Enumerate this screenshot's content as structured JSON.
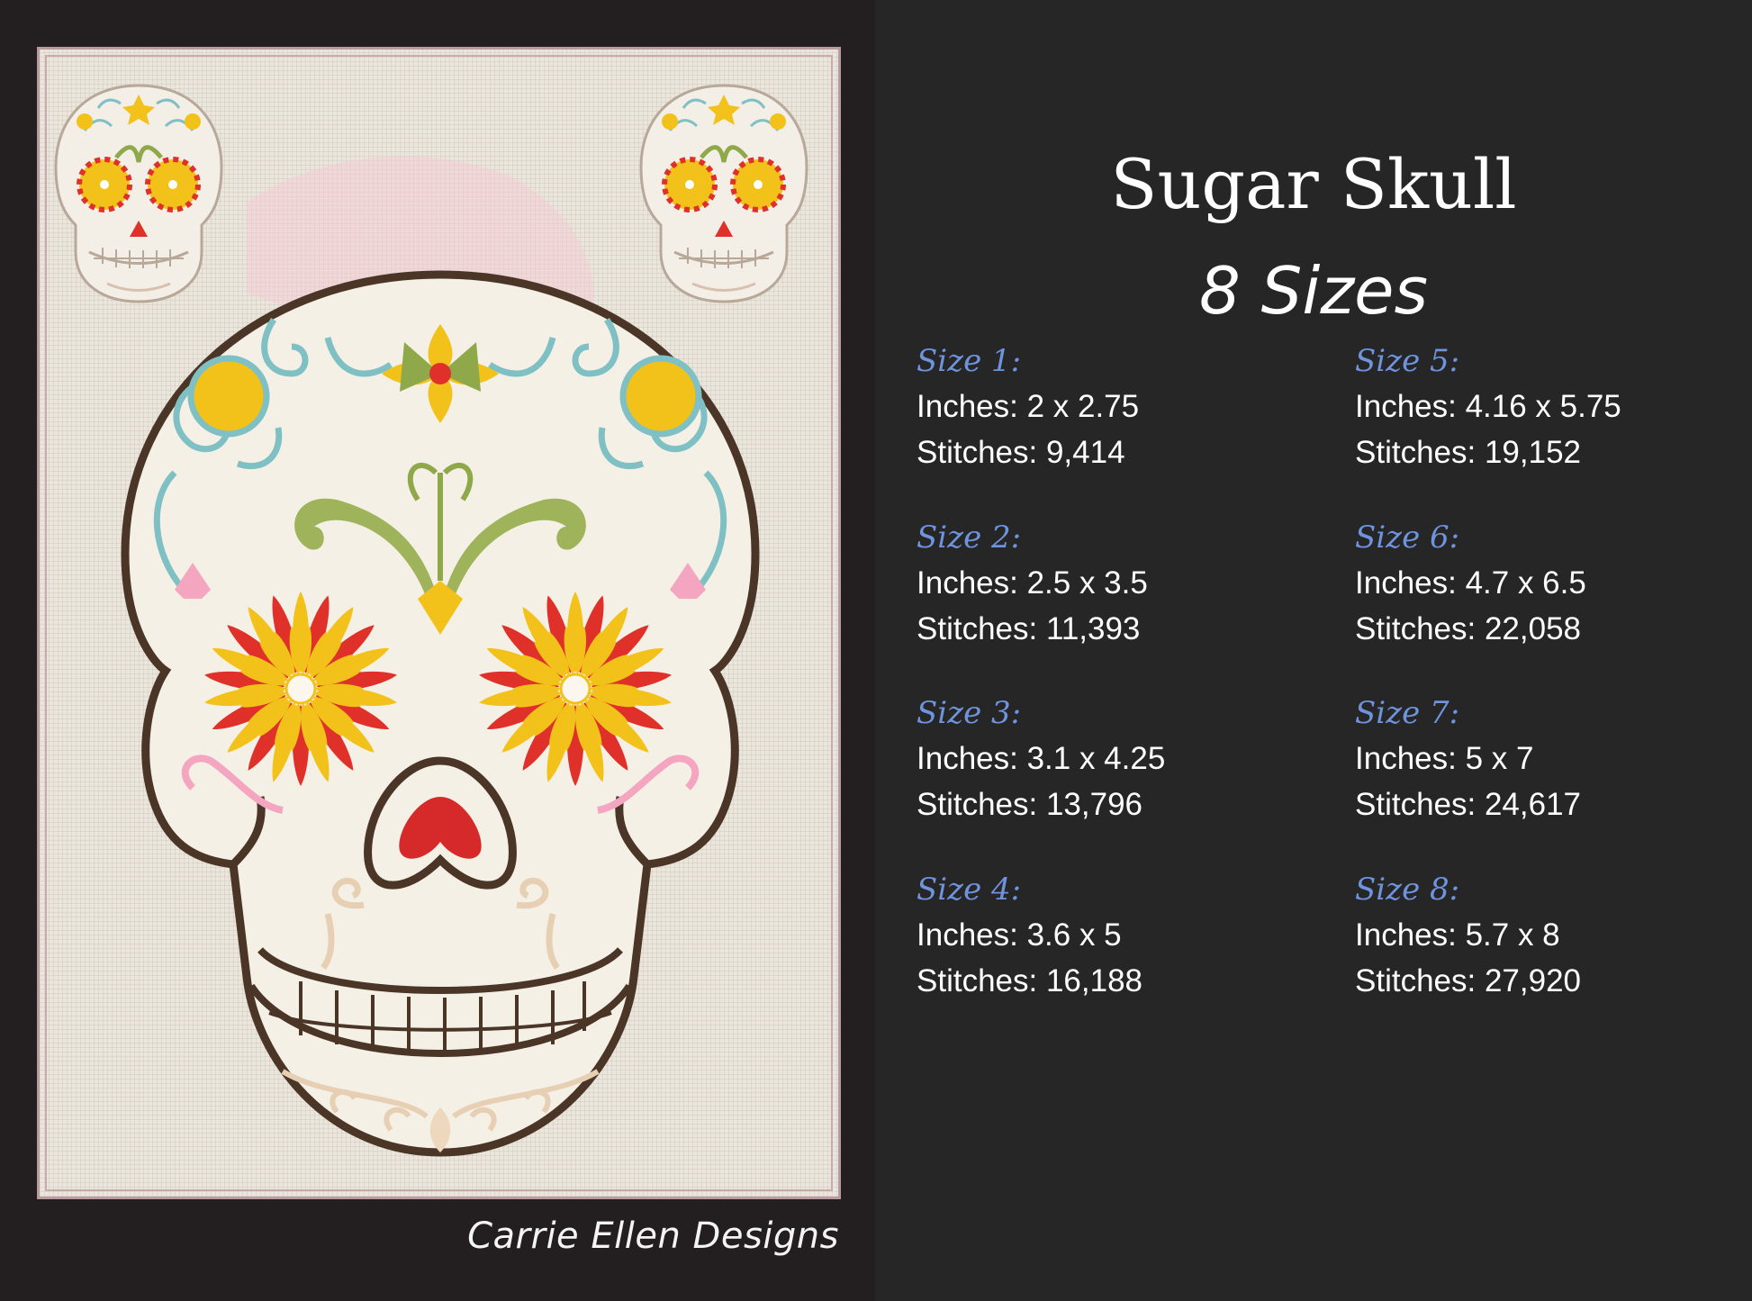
{
  "title": "Sugar Skull",
  "subtitle": "8 Sizes",
  "brand": "Carrie Ellen Designs",
  "colors": {
    "background": "#262626",
    "size_label": "#6f93dc",
    "text": "#ffffff",
    "outline": "#4a3527",
    "flower_red": "#e0302a",
    "flower_yellow": "#f2c21b",
    "leaf_green": "#8fa84a",
    "swirl_blue": "#7fc0c4"
  },
  "sizes": [
    {
      "label": "Size 1:",
      "inches": "Inches: 2 x 2.75",
      "stitches": "Stitches: 9,414"
    },
    {
      "label": "Size 2:",
      "inches": "Inches: 2.5 x 3.5",
      "stitches": "Stitches: 11,393"
    },
    {
      "label": "Size 3:",
      "inches": "Inches: 3.1 x 4.25",
      "stitches": "Stitches: 13,796"
    },
    {
      "label": "Size 4:",
      "inches": "Inches: 3.6 x 5",
      "stitches": "Stitches: 16,188"
    },
    {
      "label": "Size 5:",
      "inches": "Inches: 4.16 x 5.75",
      "stitches": "Stitches: 19,152"
    },
    {
      "label": "Size 6:",
      "inches": "Inches: 4.7 x 6.5",
      "stitches": "Stitches: 22,058"
    },
    {
      "label": "Size 7:",
      "inches": "Inches: 5 x 7",
      "stitches": "Stitches: 24,617"
    },
    {
      "label": "Size 8:",
      "inches": "Inches: 5.7 x 8",
      "stitches": "Stitches: 27,920"
    }
  ]
}
